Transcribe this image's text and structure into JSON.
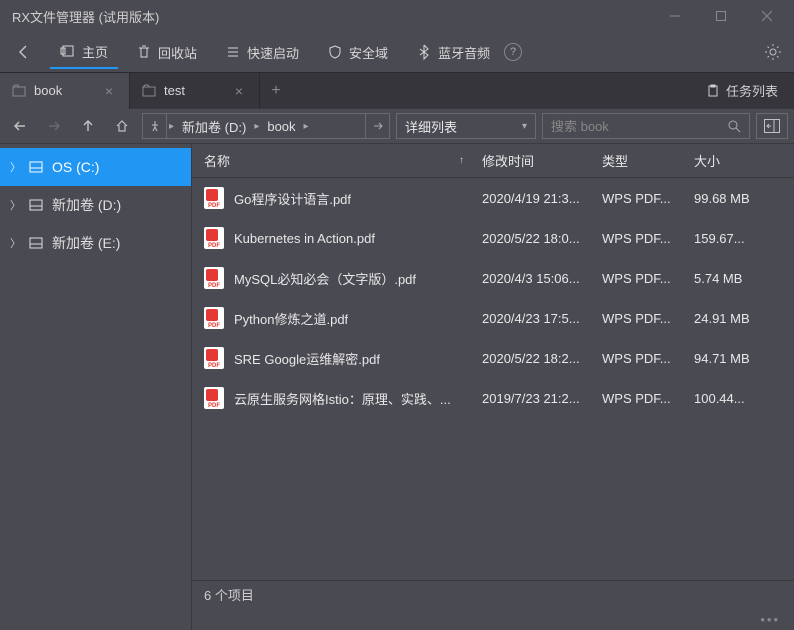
{
  "window": {
    "title": "RX文件管理器 (试用版本)"
  },
  "menu": {
    "home": "主页",
    "recycle": "回收站",
    "quick": "快速启动",
    "security": "安全域",
    "bluetooth": "蓝牙音频"
  },
  "tabs": [
    {
      "label": "book",
      "active": true
    },
    {
      "label": "test",
      "active": false
    }
  ],
  "task_list": "任务列表",
  "breadcrumb": [
    "新加卷 (D:)",
    "book"
  ],
  "viewmode": "详细列表",
  "search_placeholder": "搜索 book",
  "tree": [
    {
      "label": "OS (C:)",
      "selected": true
    },
    {
      "label": "新加卷 (D:)",
      "selected": false
    },
    {
      "label": "新加卷 (E:)",
      "selected": false
    }
  ],
  "columns": {
    "name": "名称",
    "date": "修改时间",
    "type": "类型",
    "size": "大小"
  },
  "files": [
    {
      "name": "Go程序设计语言.pdf",
      "date": "2020/4/19 21:3...",
      "type": "WPS PDF...",
      "size": "99.68 MB"
    },
    {
      "name": "Kubernetes in Action.pdf",
      "date": "2020/5/22 18:0...",
      "type": "WPS PDF...",
      "size": "159.67..."
    },
    {
      "name": "MySQL必知必会（文字版）.pdf",
      "date": "2020/4/3 15:06...",
      "type": "WPS PDF...",
      "size": "5.74 MB"
    },
    {
      "name": "Python修炼之道.pdf",
      "date": "2020/4/23 17:5...",
      "type": "WPS PDF...",
      "size": "24.91 MB"
    },
    {
      "name": "SRE  Google运维解密.pdf",
      "date": "2020/5/22 18:2...",
      "type": "WPS PDF...",
      "size": "94.71 MB"
    },
    {
      "name": "云原生服务网格Istio：原理、实践、...",
      "date": "2019/7/23 21:2...",
      "type": "WPS PDF...",
      "size": "100.44..."
    }
  ],
  "status": "6 个项目"
}
